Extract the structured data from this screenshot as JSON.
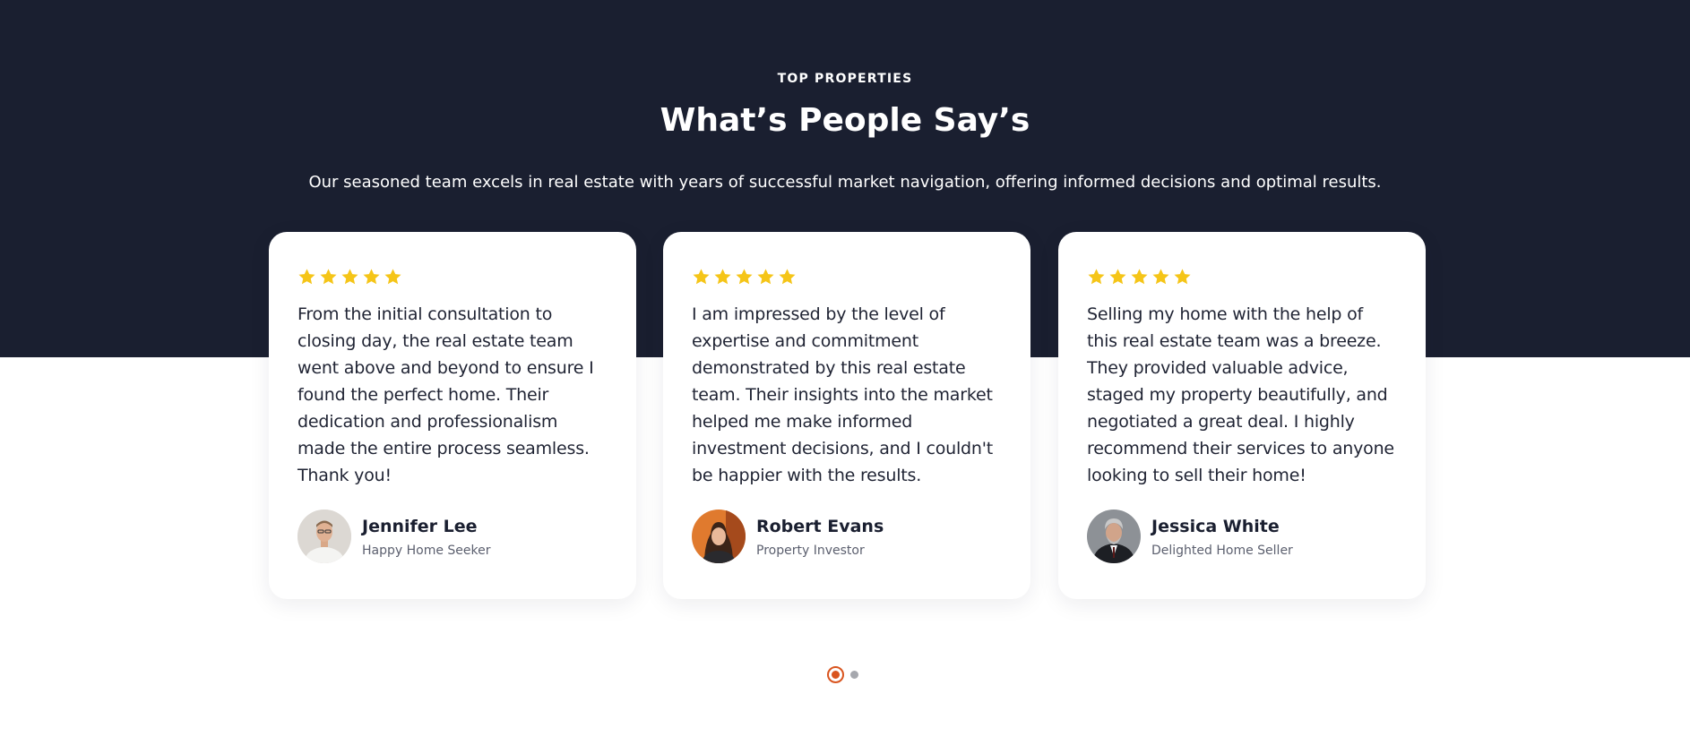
{
  "section": {
    "eyebrow": "TOP PROPERTIES",
    "title": "What’s People Say’s",
    "subtitle": "Our seasoned team excels in real estate with years of successful market navigation, offering informed decisions and optimal results."
  },
  "testimonials": [
    {
      "rating": 5,
      "quote": "From the initial consultation to closing day, the real estate team went above and beyond to ensure I found the perfect home. Their dedication and professionalism made the entire process seamless. Thank you!",
      "name": "Jennifer Lee",
      "role": "Happy Home Seeker",
      "avatar_icon": "avatar-photo"
    },
    {
      "rating": 5,
      "quote": "I am impressed by the level of expertise and commitment demonstrated by this real estate team. Their insights into the market helped me make informed investment decisions, and I couldn't be happier with the results.",
      "name": "Robert Evans",
      "role": "Property Investor",
      "avatar_icon": "avatar-photo"
    },
    {
      "rating": 5,
      "quote": "Selling my home with the help of this real estate team was a breeze. They provided valuable advice, staged my property beautifully, and negotiated a great deal. I highly recommend their services to anyone looking to sell their home!",
      "name": "Jessica White",
      "role": "Delighted Home Seller",
      "avatar_icon": "avatar-photo"
    }
  ],
  "pagination": {
    "pages": 2,
    "active_page": 1
  },
  "colors": {
    "dark_band": "#1a1f30",
    "star": "#f5c518",
    "accent": "#d9541e",
    "inactive_dot": "#a6a8ae"
  }
}
